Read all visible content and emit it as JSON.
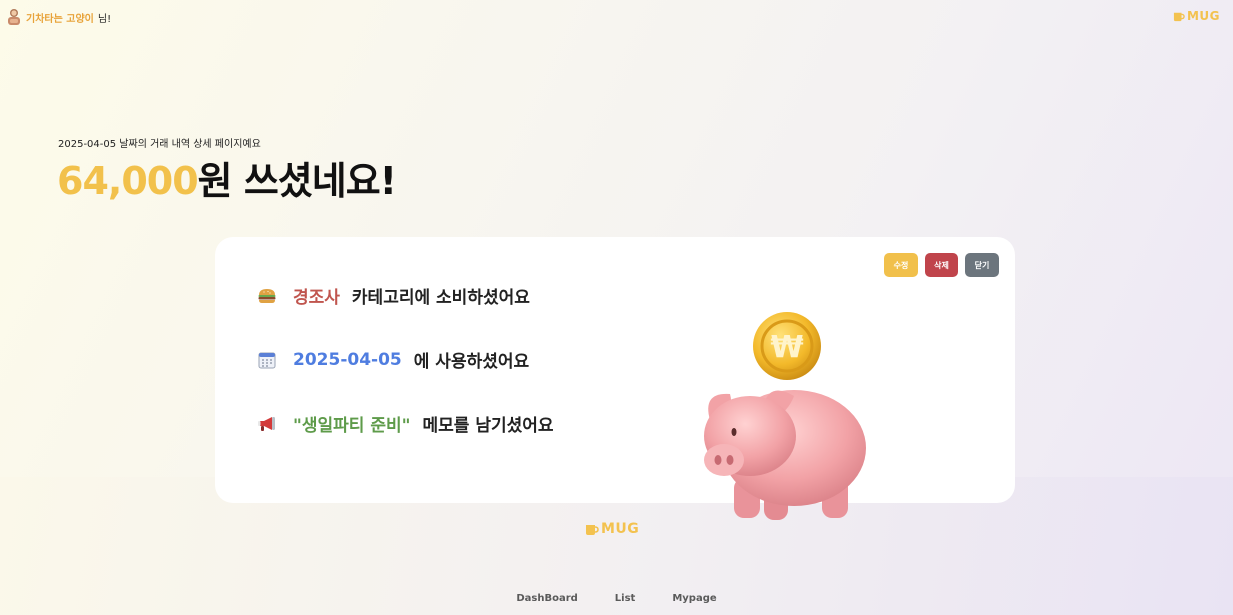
{
  "header": {
    "user_name": "기차타는 고양이",
    "user_suffix": "님!",
    "logo_text": "MUG"
  },
  "page": {
    "subtitle": "2025-04-05 날짜의 거래 내역 상세 페이지예요",
    "amount": "64,000",
    "amount_suffix": "원 쓰셨네요!"
  },
  "card": {
    "buttons": {
      "edit": "수정",
      "delete": "삭제",
      "close": "닫기"
    },
    "rows": [
      {
        "icon": "hamburger-icon",
        "value": "경조사",
        "text": "카테고리에 소비하셨어요"
      },
      {
        "icon": "calendar-icon",
        "value": "2025-04-05",
        "text": "에 사용하셨어요"
      },
      {
        "icon": "megaphone-icon",
        "value": "\"생일파티 준비\"",
        "text": "메모를 남기셨어요"
      }
    ]
  },
  "footer": {
    "logo_text": "MUG",
    "nav": [
      "DashBoard",
      "List",
      "Mypage"
    ]
  },
  "colors": {
    "accent": "#f2c14b",
    "category": "#c0554e",
    "date": "#4f7de0",
    "memo": "#5e9b4a",
    "delete": "#c0444b",
    "close": "#6c757d"
  }
}
